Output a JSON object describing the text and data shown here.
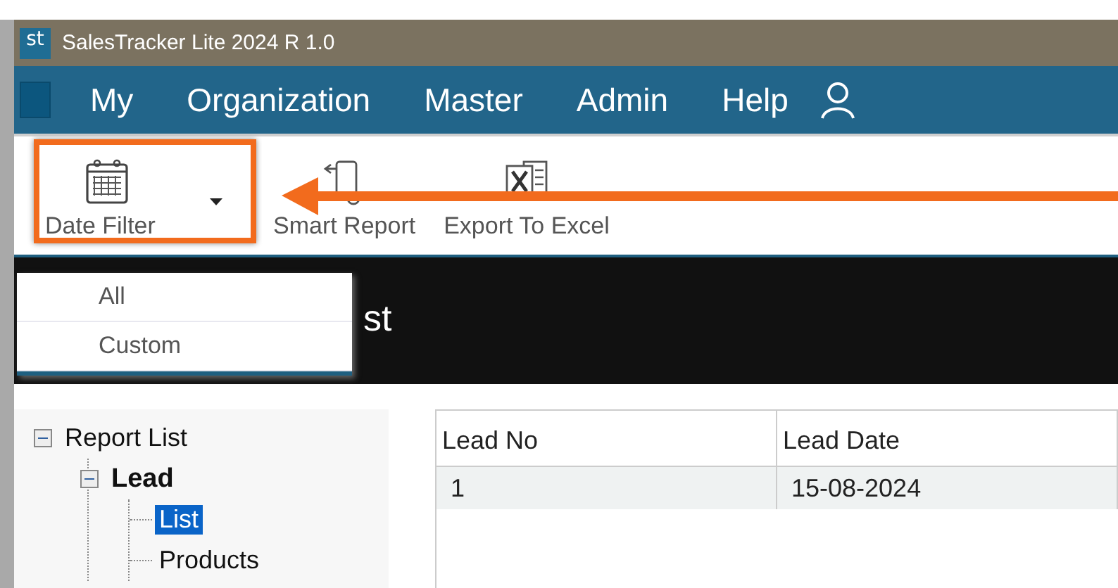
{
  "window": {
    "app_icon": "st",
    "title": "SalesTracker Lite 2024 R 1.0"
  },
  "menu": [
    {
      "label": "My"
    },
    {
      "label": "Organization"
    },
    {
      "label": "Master"
    },
    {
      "label": "Admin"
    },
    {
      "label": "Help"
    }
  ],
  "toolbar": {
    "buttons": [
      {
        "label": "Date Filter",
        "kind": "calendar",
        "dropdown": true,
        "highlighted": true
      },
      {
        "label": "Smart Report",
        "kind": "report",
        "dropdown": false,
        "highlighted": false
      },
      {
        "label": "Export To Excel",
        "kind": "excel",
        "dropdown": false,
        "highlighted": false
      }
    ],
    "dropdown_menu": [
      "All",
      "Custom"
    ]
  },
  "banner": {
    "title": "st"
  },
  "tree": [
    {
      "label": "Report List",
      "expanded": true,
      "selected": false,
      "children": [
        {
          "label": "Lead",
          "expanded": true,
          "selected": false,
          "children": [
            {
              "label": "List",
              "selected": true
            },
            {
              "label": "Products",
              "selected": false
            }
          ]
        }
      ]
    }
  ],
  "table": {
    "columns": [
      "Lead No",
      "Lead Date"
    ],
    "rows": [
      [
        "1",
        "15-08-2024"
      ]
    ]
  }
}
